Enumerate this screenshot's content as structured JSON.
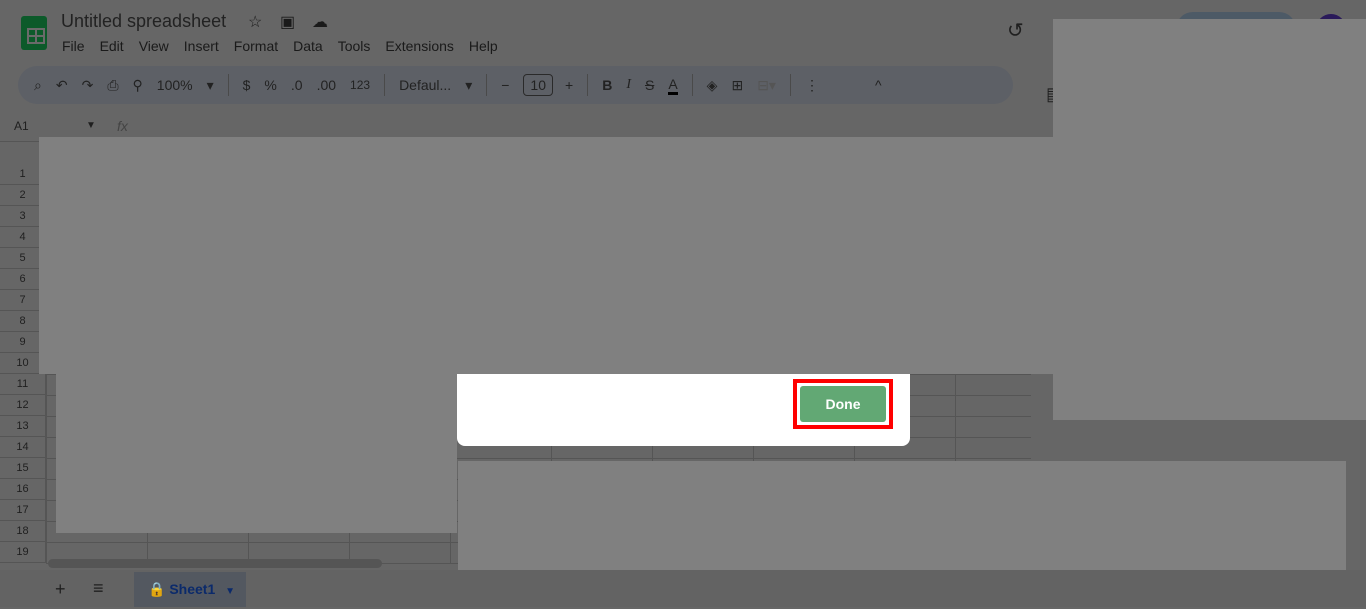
{
  "app": {
    "title": "Untitled spreadsheet",
    "icons": [
      "star-icon",
      "move-folder-icon",
      "cloud-saved-icon",
      "history-icon"
    ]
  },
  "menu": [
    "File",
    "Edit",
    "View",
    "Insert",
    "Format",
    "Data",
    "Tools",
    "Extensions",
    "Help"
  ],
  "toolbar": {
    "zoom": "100%",
    "currency": "$",
    "percent": "%",
    "dec_decrease": ".0",
    "dec_increase": ".00",
    "number_format": "123",
    "font": "Defaul...",
    "font_size": "10",
    "minus": "−",
    "plus": "+",
    "bold": "B",
    "italic": "I",
    "strike": "S",
    "text_color": "A",
    "more": "⋮",
    "collapse": "^"
  },
  "formula_bar": {
    "cell": "A1",
    "fx": "fx"
  },
  "rows": [
    "1",
    "2",
    "3",
    "4",
    "5",
    "6",
    "7",
    "8",
    "9",
    "10",
    "11",
    "12",
    "13",
    "14",
    "15",
    "16",
    "17",
    "18",
    "19"
  ],
  "dialog": {
    "done_label": "Done",
    "done_color": "#62a874",
    "highlight_color": "#ff0000"
  },
  "sheets": {
    "add": "+",
    "list": "≡",
    "tabs": [
      {
        "name": "Sheet1",
        "locked": true
      }
    ]
  }
}
